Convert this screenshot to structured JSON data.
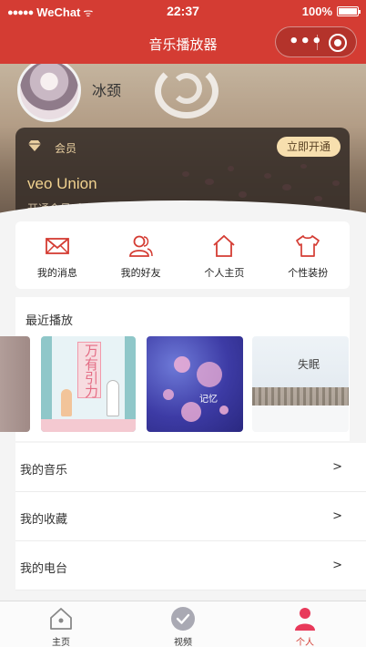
{
  "status_bar": {
    "signal": "●●●●●",
    "carrier": "WeChat",
    "wifi": "ᯤ",
    "time": "22:37",
    "battery": "100%",
    "battery_level": 1.0
  },
  "nav": {
    "title": "音乐播放器",
    "more": "•••"
  },
  "profile": {
    "username": "冰颈"
  },
  "vip": {
    "label": "会员",
    "button": "立即开通",
    "title": "veo Union",
    "subtitle": "开通会员听歌，撸代码"
  },
  "actions": [
    {
      "label": "我的消息",
      "icon": "envelope-icon"
    },
    {
      "label": "我的好友",
      "icon": "friends-icon"
    },
    {
      "label": "个人主页",
      "icon": "home-icon"
    },
    {
      "label": "个性装扮",
      "icon": "tshirt-icon"
    }
  ],
  "recent": {
    "title": "最近播放",
    "covers": [
      {
        "title": "",
        "icon": "album-cover-partial"
      },
      {
        "title": "万有引力",
        "icon": "album-cover-wanyouyinli"
      },
      {
        "title": "记忆",
        "icon": "album-cover-bubbles"
      },
      {
        "title": "失眠",
        "icon": "album-cover-winter"
      }
    ]
  },
  "menu": [
    {
      "label": "我的音乐",
      "arrow": ">"
    },
    {
      "label": "我的收藏",
      "arrow": ">"
    },
    {
      "label": "我的电台",
      "arrow": ">"
    }
  ],
  "tabbar": [
    {
      "label": "主页",
      "icon": "home-tab-icon",
      "active": false
    },
    {
      "label": "视频",
      "icon": "check-circle-icon",
      "active": false
    },
    {
      "label": "个人",
      "icon": "person-icon",
      "active": true
    }
  ],
  "colors": {
    "primary": "#d43c33",
    "vip_gold": "#f1d28f",
    "icon_red": "#d43c33"
  }
}
